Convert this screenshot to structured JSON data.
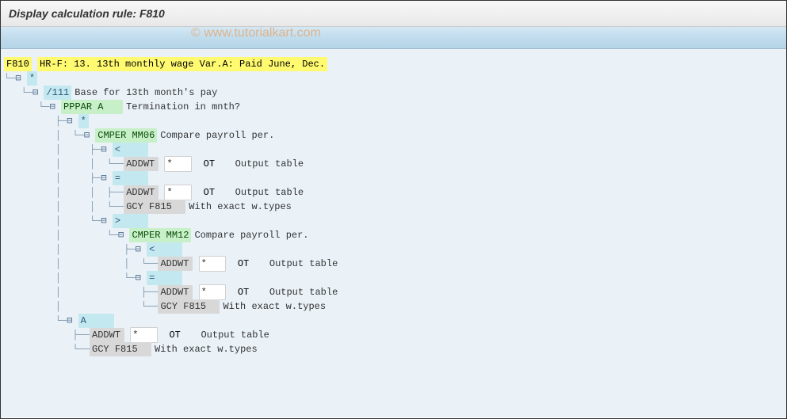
{
  "header": {
    "title": "Display calculation rule: F810"
  },
  "watermark": "© www.tutorialkart.com",
  "tree": {
    "root": {
      "code": "F810",
      "title": "HR-F: 13. 13th monthly wage Var.A: Paid June, Dec."
    },
    "star": "*",
    "wage": {
      "code": "/111",
      "desc": "Base for 13th month's pay"
    },
    "pppar": {
      "op": "PPPAR A   ",
      "desc": "Termination in mnth?"
    },
    "star2": "*",
    "cmper1": {
      "op": "CMPER MM06",
      "desc": "Compare payroll per."
    },
    "lt": "<    ",
    "eq": "=    ",
    "gt": ">    ",
    "addwt": {
      "op": "ADDWT *   ",
      "mid": "OT",
      "desc": "Output table"
    },
    "gcy": {
      "op": "GCY F815  ",
      "desc": "With exact w.types"
    },
    "cmper2": {
      "op": "CMPER MM12",
      "desc": "Compare payroll per."
    },
    "branchA": "A    "
  }
}
